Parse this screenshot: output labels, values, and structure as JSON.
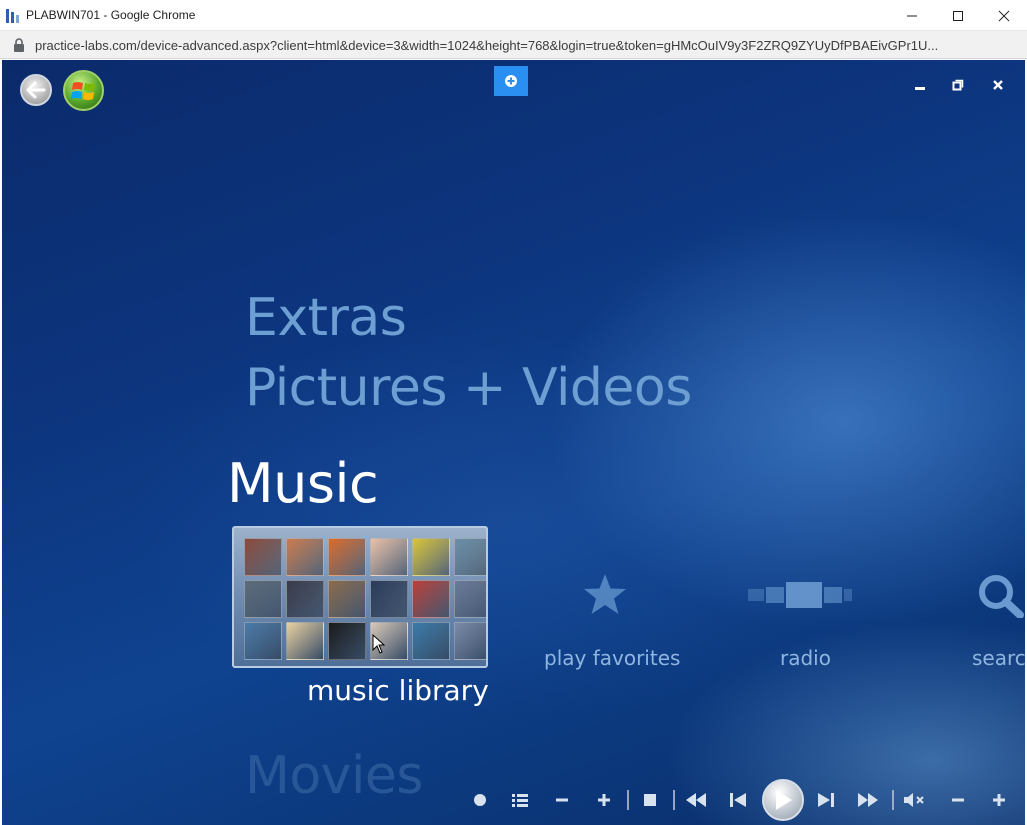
{
  "browser": {
    "window_title": "PLABWIN701 - Google Chrome",
    "url": "practice-labs.com/device-advanced.aspx?client=html&device=3&width=1024&height=768&login=true&token=gHMcOuIV9y3F2ZRQ9ZYUyDfPBAEivGPr1U..."
  },
  "media_center": {
    "menu_strips": {
      "extras": "Extras",
      "pictures": "Pictures + Videos",
      "music": "Music",
      "movies": "Movies"
    },
    "music_options": {
      "library": "music library",
      "favorites": "play favorites",
      "radio": "radio",
      "search": "search"
    }
  },
  "album_colors": [
    "#8a4a3c",
    "#c97b4e",
    "#d96a2a",
    "#e8c0a8",
    "#d8c43a",
    "#6a8fa8",
    "#5a6a7a",
    "#3a3a4a",
    "#8a6a4a",
    "#2a3a5a",
    "#b8403a",
    "#6a7a9a",
    "#4a7aa8",
    "#e8d0a0",
    "#1a1a1a",
    "#d8c8b8",
    "#3a7aa8",
    "#7a8aa8"
  ]
}
